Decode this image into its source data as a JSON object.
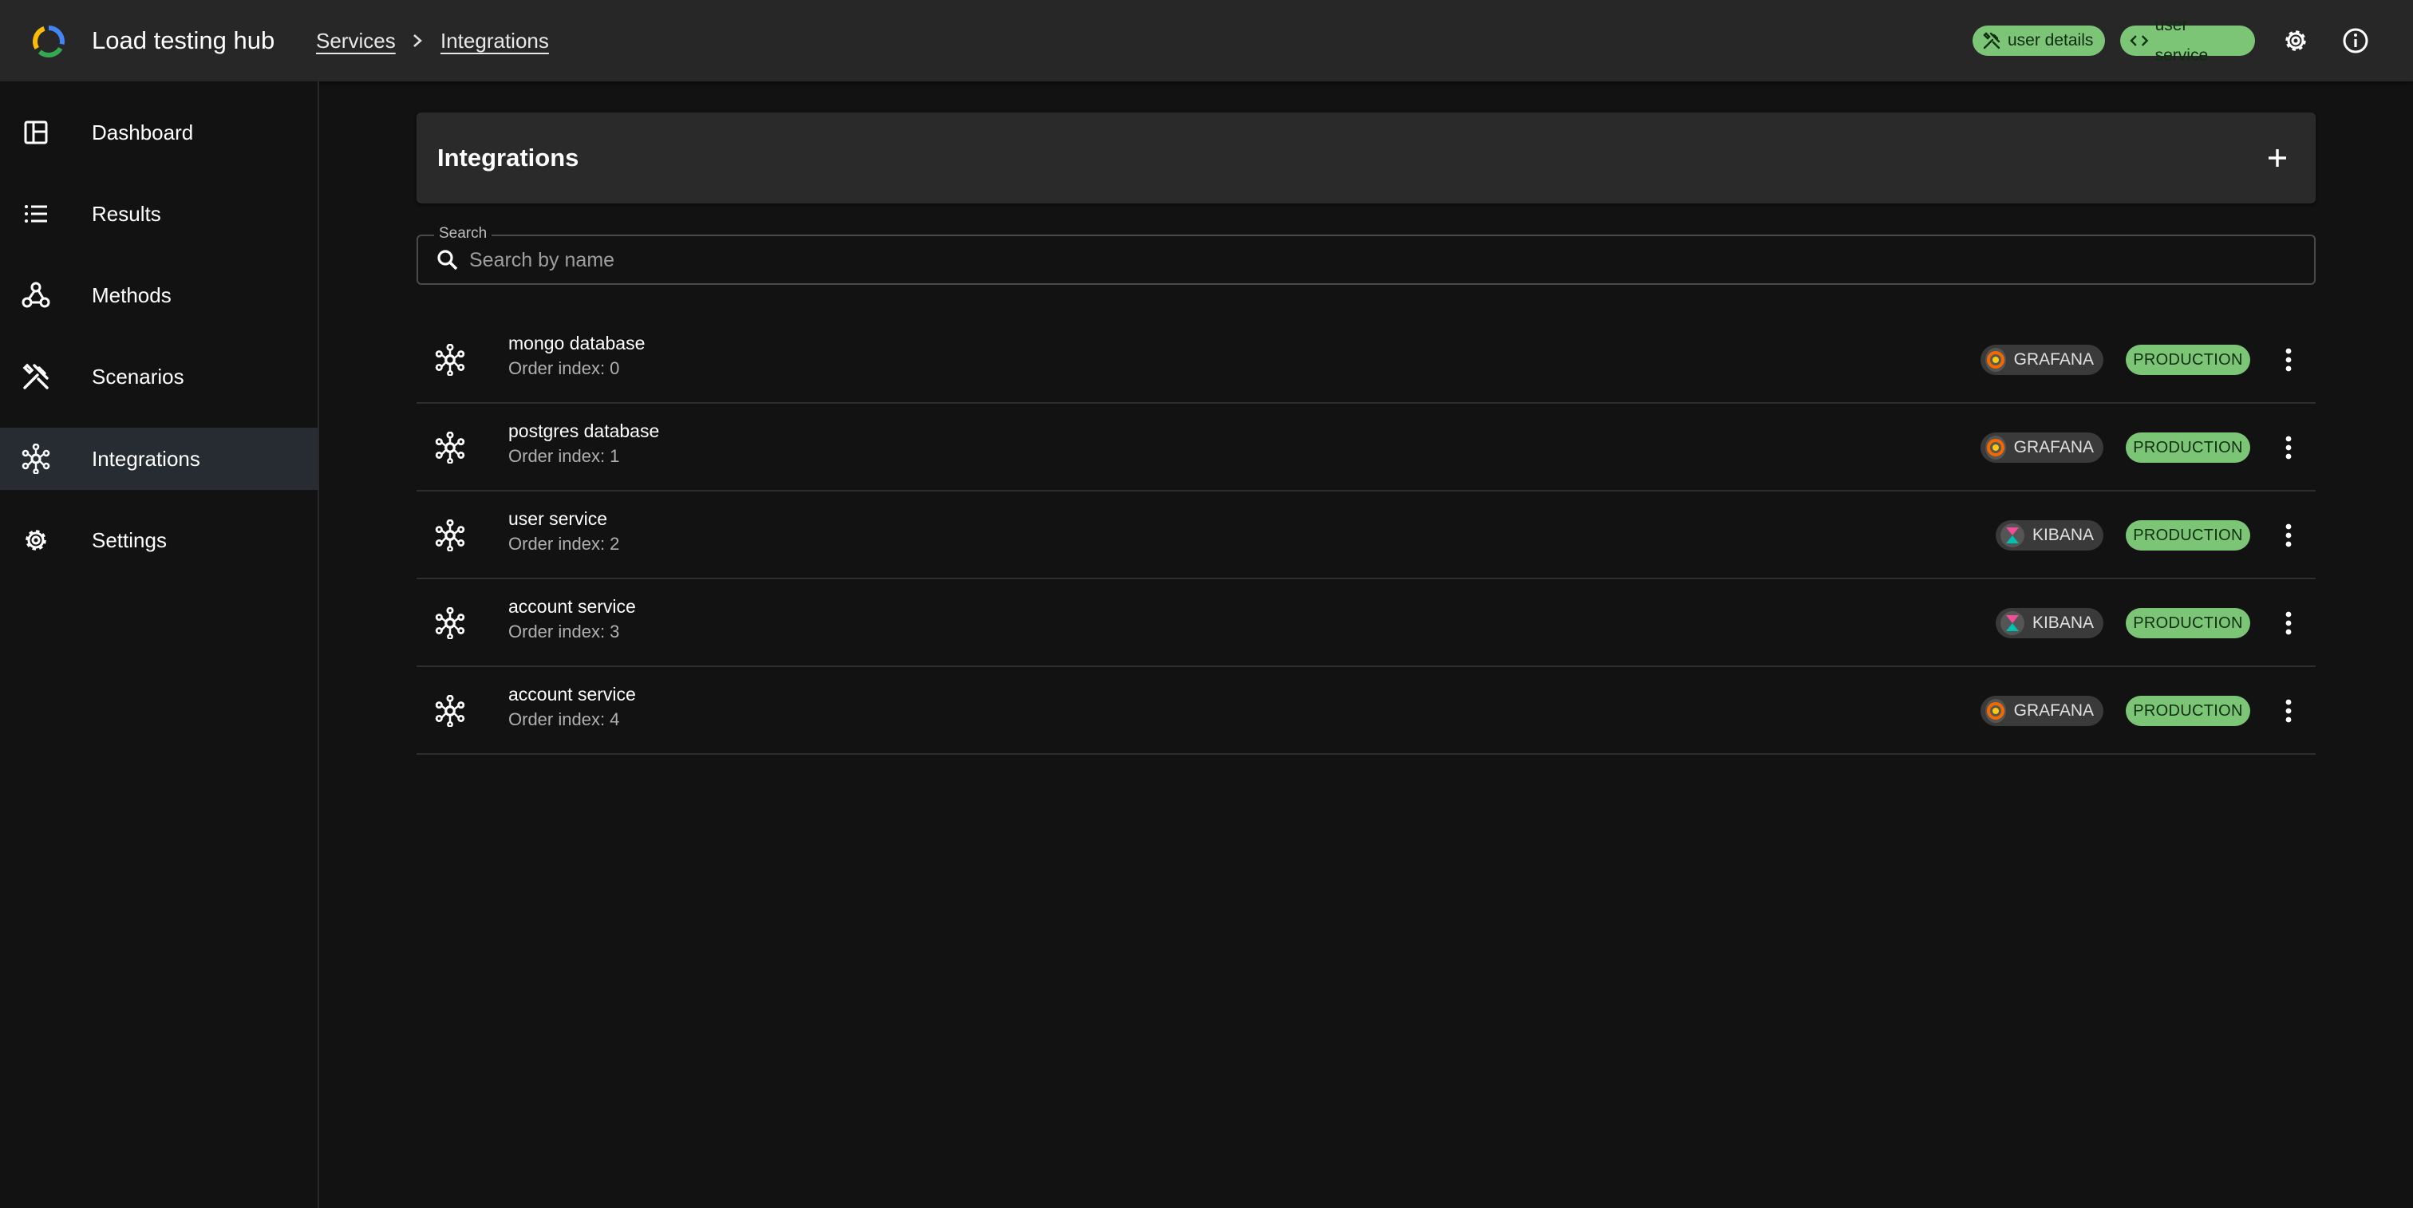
{
  "app": {
    "title": "Load testing hub",
    "breadcrumbs": [
      "Services",
      "Integrations"
    ],
    "chips": [
      {
        "label": "user details",
        "icon": "tools-icon"
      },
      {
        "label": "user service",
        "icon": "code-icon"
      }
    ],
    "icons": [
      "gear-icon",
      "info-icon"
    ],
    "accent_color": "#7cc576"
  },
  "sidebar": {
    "items": [
      {
        "label": "Dashboard",
        "icon": "dashboard-icon",
        "active": false
      },
      {
        "label": "Results",
        "icon": "list-icon",
        "active": false
      },
      {
        "label": "Methods",
        "icon": "webhook-icon",
        "active": false
      },
      {
        "label": "Scenarios",
        "icon": "tools-icon",
        "active": false
      },
      {
        "label": "Integrations",
        "icon": "hub-icon",
        "active": true
      },
      {
        "label": "Settings",
        "icon": "gear-icon",
        "active": false
      }
    ]
  },
  "main": {
    "title": "Integrations",
    "search": {
      "label": "Search",
      "placeholder": "Search by name",
      "value": ""
    },
    "rows": [
      {
        "name": "mongo database",
        "sub": "Order index: 0",
        "tool": "GRAFANA",
        "env": "PRODUCTION"
      },
      {
        "name": "postgres database",
        "sub": "Order index: 1",
        "tool": "GRAFANA",
        "env": "PRODUCTION"
      },
      {
        "name": "user service",
        "sub": "Order index: 2",
        "tool": "KIBANA",
        "env": "PRODUCTION"
      },
      {
        "name": "account service",
        "sub": "Order index: 3",
        "tool": "KIBANA",
        "env": "PRODUCTION"
      },
      {
        "name": "account service",
        "sub": "Order index: 4",
        "tool": "GRAFANA",
        "env": "PRODUCTION"
      }
    ]
  }
}
